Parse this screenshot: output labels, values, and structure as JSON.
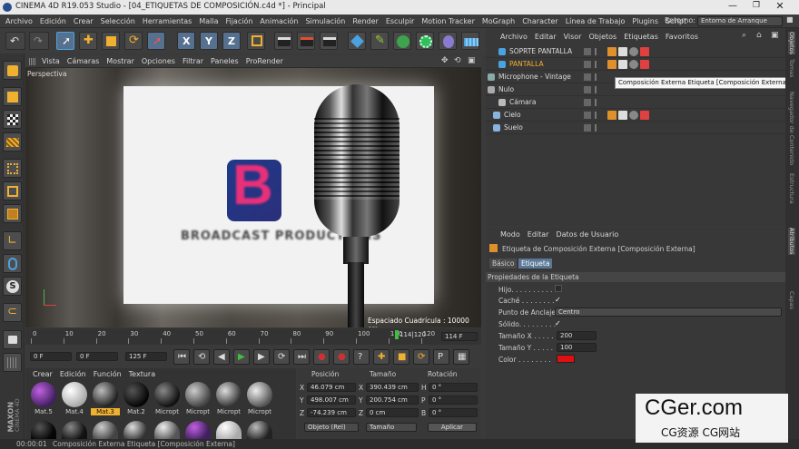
{
  "window": {
    "title": "CINEMA 4D R19.053 Studio - [04_ETIQUETAS DE COMPOSICIÓN.c4d *] - Principal"
  },
  "menu": [
    "Archivo",
    "Edición",
    "Crear",
    "Selección",
    "Herramientas",
    "Malla",
    "Fijación",
    "Animación",
    "Simulación",
    "Render",
    "Esculpir",
    "Motion Tracker",
    "MoGraph",
    "Character",
    "Línea de Trabajo",
    "Plugins",
    "Script"
  ],
  "layout": {
    "label": "Entorno:",
    "value": "Entorno de Arranque"
  },
  "toolbar": {
    "axis_x": "X",
    "axis_y": "Y",
    "axis_z": "Z"
  },
  "viewport": {
    "menu": [
      "Vista",
      "Cámaras",
      "Mostrar",
      "Opciones",
      "Filtrar",
      "Paneles",
      "ProRender"
    ],
    "camera_label": "Perspectiva",
    "grid_text": "Espaciado Cuadrícula : 10000 cm",
    "logo_letter": "B",
    "logo_text": "BROADCAST PRODUCTIONS"
  },
  "timeline": {
    "ticks": [
      "0",
      "10",
      "20",
      "30",
      "40",
      "50",
      "60",
      "70",
      "80",
      "90",
      "100",
      "110",
      "120"
    ],
    "current_frame": "114",
    "frame_marker": "114|120",
    "end_field": "114 F"
  },
  "playback": {
    "start": "0 F",
    "current": "0 F",
    "end": "125 F"
  },
  "materials": {
    "menu": [
      "Crear",
      "Edición",
      "Función",
      "Textura"
    ],
    "items": [
      "Mat.5",
      "Mat.4",
      "Mat.3",
      "Mat.2",
      "Micropt",
      "Micropt",
      "Micropt",
      "Micropt"
    ]
  },
  "coords": {
    "headers": [
      "Posición",
      "Tamaño",
      "Rotación"
    ],
    "rows": [
      {
        "axis": "X",
        "pos": "46.079 cm",
        "size": "390.439 cm",
        "rot_axis": "H",
        "rot": "0 °"
      },
      {
        "axis": "Y",
        "pos": "498.007 cm",
        "size": "200.754 cm",
        "rot_axis": "P",
        "rot": "0 °"
      },
      {
        "axis": "Z",
        "pos": "-74.239 cm",
        "size": "0 cm",
        "rot_axis": "B",
        "rot": "0 °"
      }
    ],
    "mode": "Objeto (Rel)",
    "size_mode": "Tamaño",
    "apply": "Aplicar"
  },
  "objects": {
    "menu": [
      "Archivo",
      "Editar",
      "Visor",
      "Objetos",
      "Etiquetas",
      "Favoritos"
    ],
    "rows": [
      "SOPRTE PANTALLA",
      "PANTALLA",
      "Microphone - Vintage",
      "Nulo",
      "Cámara",
      "Cielo",
      "Suelo"
    ],
    "tooltip": "Composición Externa Etiqueta [Composición Externa]"
  },
  "attributes": {
    "menu": [
      "Modo",
      "Editar",
      "Datos de Usuario"
    ],
    "title": "Etiqueta de Composición Externa [Composición Externa]",
    "tabs": [
      "Básico",
      "Etiqueta"
    ],
    "section": "Propiedades de la Etiqueta",
    "props": {
      "hijo": "Hijo. . . . . . . . . .",
      "cache": "Caché . . . . . . . .",
      "anchor": "Punto de Anclaje",
      "anchor_value": "Centro",
      "solido": "Sólido. . . . . . . . .",
      "size_x": "Tamaño X . . . . .",
      "size_x_value": "200",
      "size_y": "Tamaño Y . . . . .",
      "size_y_value": "100",
      "color": "Color . . . . . . . ."
    },
    "color_value": "#e01010"
  },
  "right_tabs": [
    "Objetos",
    "Tomas",
    "Navegador de Contenido",
    "Estructura",
    "Atributos",
    "Capas"
  ],
  "status": {
    "time": "00:00:01",
    "message": "Composición Externa Etiqueta [Composición Externa]"
  },
  "logo_side": {
    "brand": "MAXON",
    "product": "CINEMA 4D"
  },
  "watermark": {
    "main": "CGer.com",
    "sub": "CG资源 CG网站"
  },
  "colors": {
    "accent": "#4aa3e0",
    "highlight_row": "#f0b030",
    "record": "#d03030"
  }
}
